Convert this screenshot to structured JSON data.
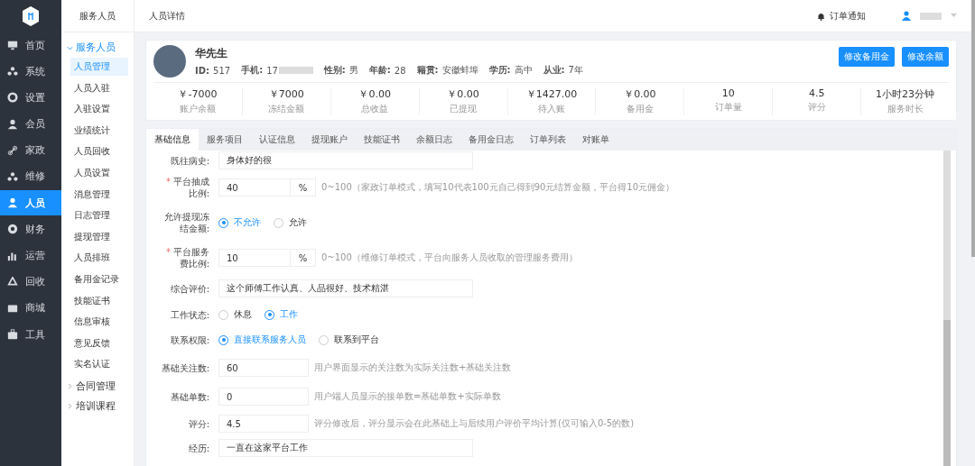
{
  "sidebar": {
    "items": [
      {
        "label": "首页",
        "selected": false
      },
      {
        "label": "系统",
        "selected": false
      },
      {
        "label": "设置",
        "selected": false
      },
      {
        "label": "会员",
        "selected": false
      },
      {
        "label": "家政",
        "selected": false
      },
      {
        "label": "维修",
        "selected": false
      },
      {
        "label": "人员",
        "selected": true
      },
      {
        "label": "财务",
        "selected": false
      },
      {
        "label": "运营",
        "selected": false
      },
      {
        "label": "回收",
        "selected": false
      },
      {
        "label": "商城",
        "selected": false
      },
      {
        "label": "工具",
        "selected": false
      }
    ]
  },
  "submenu": {
    "title": "服务人员",
    "groups": [
      {
        "label": "服务人员",
        "expanded": true,
        "children": [
          {
            "label": "人员管理",
            "selected": true
          },
          {
            "label": "人员入驻",
            "selected": false
          },
          {
            "label": "入驻设置",
            "selected": false
          },
          {
            "label": "业绩统计",
            "selected": false
          },
          {
            "label": "人员回收",
            "selected": false
          },
          {
            "label": "人员设置",
            "selected": false
          },
          {
            "label": "消息管理",
            "selected": false
          },
          {
            "label": "日志管理",
            "selected": false
          },
          {
            "label": "提现管理",
            "selected": false
          },
          {
            "label": "人员排班",
            "selected": false
          },
          {
            "label": "备用金记录",
            "selected": false
          },
          {
            "label": "技能证书",
            "selected": false
          },
          {
            "label": "信息审核",
            "selected": false
          },
          {
            "label": "意见反馈",
            "selected": false
          },
          {
            "label": "实名认证",
            "selected": false
          }
        ]
      },
      {
        "label": "合同管理",
        "expanded": false
      },
      {
        "label": "培训课程",
        "expanded": false
      }
    ]
  },
  "header": {
    "title": "人员详情",
    "notification": "订单通知"
  },
  "profile": {
    "name": "华先生",
    "fields": [
      {
        "label": "ID:",
        "value": "517"
      },
      {
        "label": "手机:",
        "value": "17",
        "redacted": true
      },
      {
        "label": "性别:",
        "value": "男"
      },
      {
        "label": "年龄:",
        "value": "28"
      },
      {
        "label": "籍贯:",
        "value": "安徽蚌埠"
      },
      {
        "label": "学历:",
        "value": "高中"
      },
      {
        "label": "从业:",
        "value": "7年"
      }
    ],
    "buttons": [
      "修改备用金",
      "修改余额"
    ],
    "stats": [
      {
        "value": "￥-7000",
        "label": "账户余额"
      },
      {
        "value": "￥7000",
        "label": "冻结金额"
      },
      {
        "value": "￥0.00",
        "label": "总收益"
      },
      {
        "value": "￥0.00",
        "label": "已提现"
      },
      {
        "value": "￥1427.00",
        "label": "待入账"
      },
      {
        "value": "￥0.00",
        "label": "备用金"
      },
      {
        "value": "10",
        "label": "订单量"
      },
      {
        "value": "4.5",
        "label": "评分"
      },
      {
        "value": "1小时23分钟",
        "label": "服务时长"
      }
    ]
  },
  "tabs": [
    {
      "label": "基础信息",
      "selected": true
    },
    {
      "label": "服务项目",
      "selected": false
    },
    {
      "label": "认证信息",
      "selected": false
    },
    {
      "label": "提现账户",
      "selected": false
    },
    {
      "label": "技能证书",
      "selected": false
    },
    {
      "label": "余额日志",
      "selected": false
    },
    {
      "label": "备用金日志",
      "selected": false
    },
    {
      "label": "订单列表",
      "selected": false
    },
    {
      "label": "对账单",
      "selected": false
    }
  ],
  "form": [
    {
      "kind": "input",
      "label": "既往病史:",
      "value": "身体好的很"
    },
    {
      "kind": "input",
      "marker": "*",
      "label": "平台抽成比例:",
      "value": "40",
      "suffix": "%",
      "hint": "0~100（家政订单模式，填写10代表100元自己得到90元结算金额，平台得10元佣金）"
    },
    {
      "kind": "radio",
      "label": "允许提现冻结金额:",
      "options": [
        {
          "label": "不允许",
          "selected": true
        },
        {
          "label": "允许",
          "selected": false
        }
      ]
    },
    {
      "kind": "input",
      "marker": "*",
      "label": "平台服务费比例:",
      "value": "10",
      "suffix": "%",
      "hint": "0~100（维修订单模式，平台向服务人员收取的管理服务费用）"
    },
    {
      "kind": "input",
      "label": "综合评价:",
      "value": "这个师傅工作认真、人品很好、技术精湛"
    },
    {
      "kind": "radio",
      "label": "工作状态:",
      "options": [
        {
          "label": "休息",
          "selected": false
        },
        {
          "label": "工作",
          "selected": true
        }
      ]
    },
    {
      "kind": "radio",
      "label": "联系权限:",
      "options": [
        {
          "label": "直接联系服务人员",
          "selected": true
        },
        {
          "label": "联系到平台",
          "selected": false
        }
      ]
    },
    {
      "kind": "input",
      "label": "基础关注数:",
      "value": "60",
      "hint": "用户界面显示的关注数为实际关注数+基础关注数"
    },
    {
      "kind": "input",
      "label": "基础单数:",
      "value": "0",
      "hint": "用户端人员显示的接单数=基础单数+实际单数"
    },
    {
      "kind": "input",
      "label": "评分:",
      "value": "4.5",
      "hint": "评分修改后，评分显示会在此基础上与后续用户评价平均计算(仅可输入0-5的数)"
    },
    {
      "kind": "input",
      "label": "经历:",
      "value": "一直在这家平台工作"
    }
  ]
}
